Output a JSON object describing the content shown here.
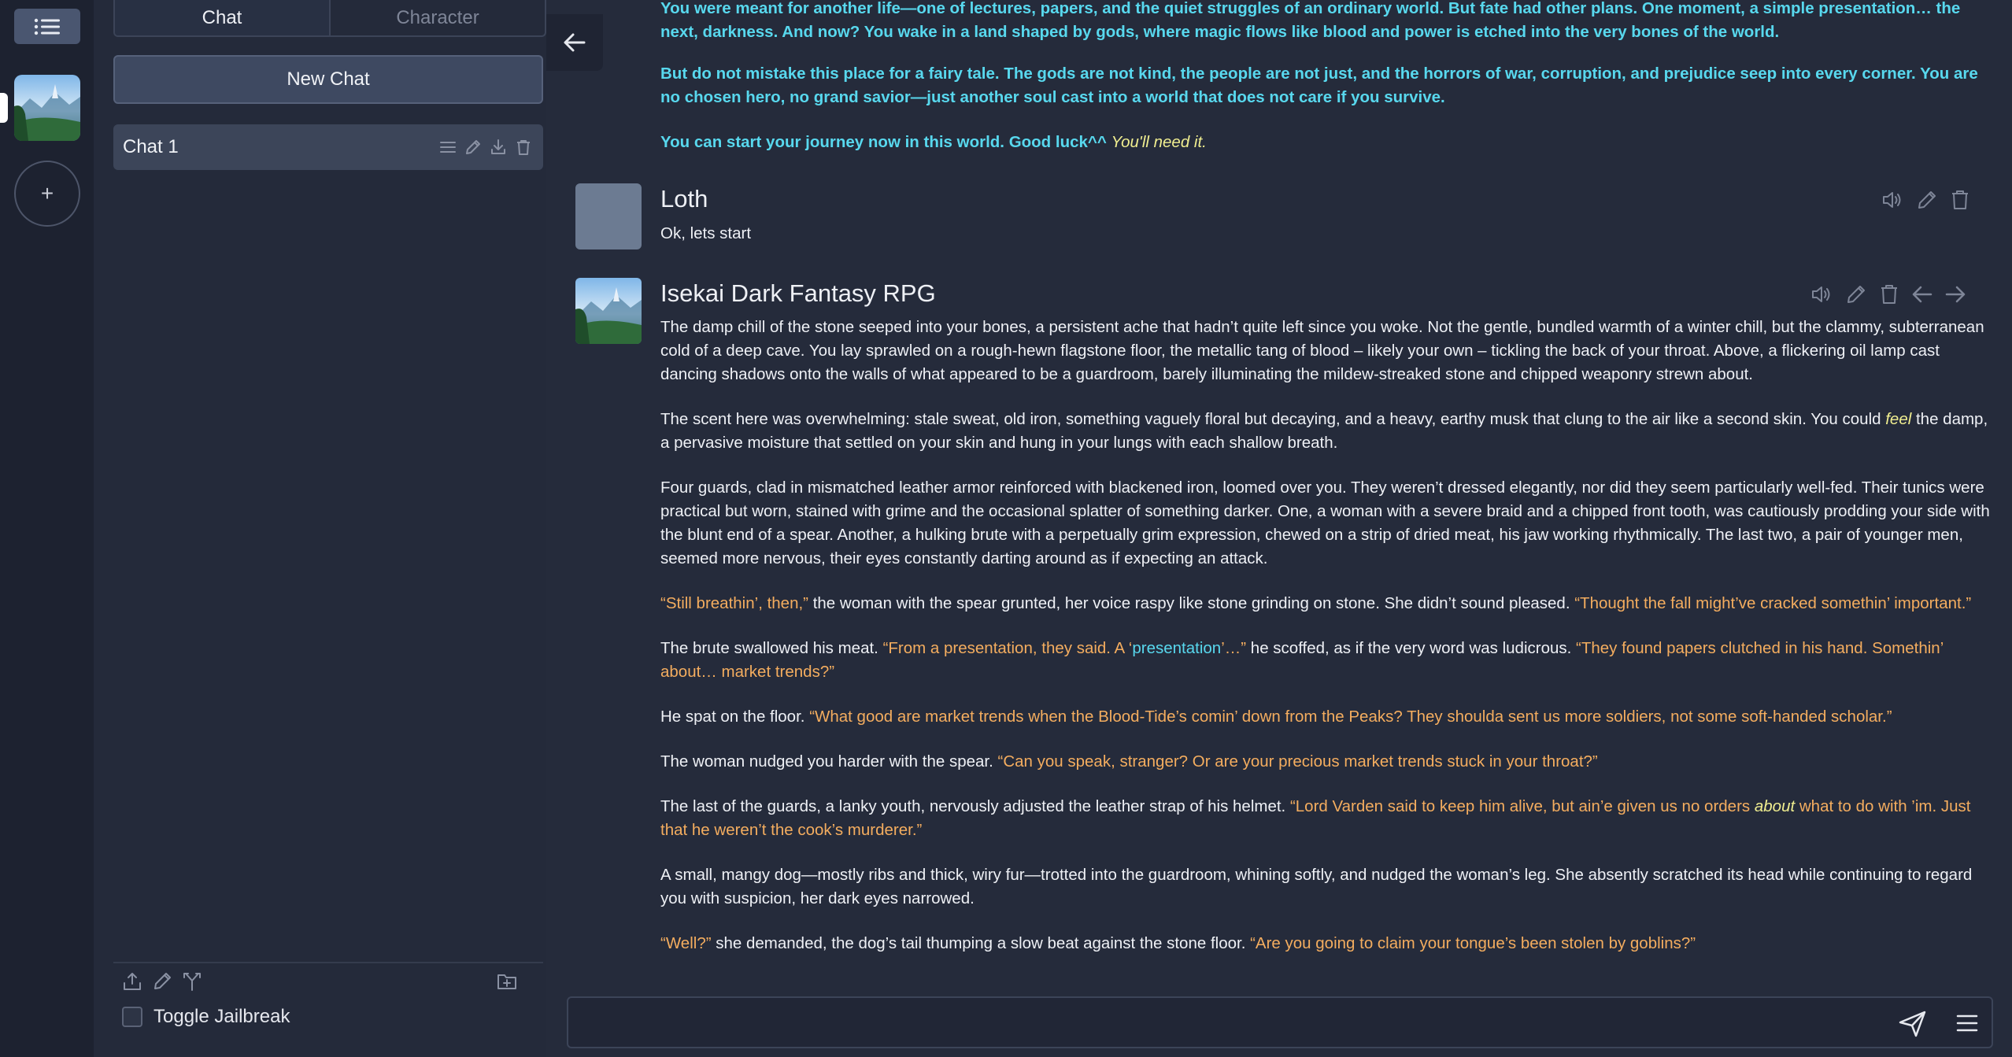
{
  "sidebar": {
    "menu_icon": "list-icon",
    "character_avatar": "fantasy-landscape-thumbnail",
    "add_icon": "plus-icon"
  },
  "panel": {
    "tabs": [
      {
        "label": "Chat",
        "active": true
      },
      {
        "label": "Character",
        "active": false
      }
    ],
    "new_chat_label": "New Chat",
    "chats": [
      {
        "label": "Chat 1",
        "icons": [
          "menu-icon",
          "pencil-icon",
          "download-icon",
          "trash-icon"
        ]
      }
    ],
    "footer_icons": [
      "upload-icon",
      "pencil-icon",
      "branch-icon",
      "folder-plus-icon"
    ],
    "jailbreak_label": "Toggle Jailbreak",
    "jailbreak_checked": false
  },
  "intro": {
    "p1": "You were meant for another life—one of lectures, papers, and the quiet struggles of an ordinary world. But fate had other plans. One moment, a simple presentation… the next, darkness. And now? You wake in a land shaped by gods, where magic flows like blood and power is etched into the very bones of the world.",
    "p2": "But do not mistake this place for a fairy tale. The gods are not kind, the people are not just, and the horrors of war, corruption, and prejudice seep into every corner. You are no chosen hero, no grand savior—just another soul cast into a world that does not care if you survive.",
    "p3_main": "You can start your journey now in this world. Good luck^^ ",
    "p3_italic": "You'll need it."
  },
  "messages": [
    {
      "name": "Loth",
      "text": "Ok, lets start",
      "actions": [
        "speaker-icon",
        "pencil-icon",
        "trash-icon"
      ]
    },
    {
      "name": "Isekai Dark Fantasy RPG",
      "actions": [
        "speaker-icon",
        "pencil-icon",
        "trash-icon",
        "arrow-left-icon",
        "arrow-right-icon"
      ],
      "paragraphs": [
        [
          {
            "t": "The damp chill of the stone seeped into your bones, a persistent ache that hadn’t quite left since you woke. Not the gentle, bundled warmth of a winter chill, but the clammy, subterranean cold of a deep cave. You lay sprawled on a rough-hewn flagstone floor, the metallic tang of blood – likely your own – tickling the back of your throat. Above, a flickering oil lamp cast dancing shadows onto the walls of what appeared to be a guardroom, barely illuminating the mildew-streaked stone and chipped weaponry strewn about.",
            "s": ""
          }
        ],
        [
          {
            "t": "The scent here was overwhelming: stale sweat, old iron, something vaguely floral but decaying, and a heavy, earthy musk that clung to the air like a second skin. You could ",
            "s": ""
          },
          {
            "t": "feel",
            "s": "it"
          },
          {
            "t": " the damp, a pervasive moisture that settled on your skin and hung in your lungs with each shallow breath.",
            "s": ""
          }
        ],
        [
          {
            "t": "Four guards, clad in mismatched leather armor reinforced with blackened iron, loomed over you. They weren’t dressed elegantly, nor did they seem particularly well-fed. Their tunics were practical but worn, stained with grime and the occasional splatter of something darker. One, a woman with a severe braid and a chipped front tooth, was cautiously prodding your side with the blunt end of a spear. Another, a hulking brute with a perpetually grim expression, chewed on a strip of dried meat, his jaw working rhythmically. The last two, a pair of younger men, seemed more nervous, their eyes constantly darting around as if expecting an attack.",
            "s": ""
          }
        ],
        [
          {
            "t": "“Still breathin’, then,”",
            "s": "q"
          },
          {
            "t": " the woman with the spear grunted, her voice raspy like stone grinding on stone. She didn’t sound pleased. ",
            "s": ""
          },
          {
            "t": "“Thought the fall might’ve cracked somethin’ important.”",
            "s": "q"
          }
        ],
        [
          {
            "t": "The brute swallowed his meat. ",
            "s": ""
          },
          {
            "t": "“From a presentation, they said. A ‘",
            "s": "q"
          },
          {
            "t": "presentation",
            "s": "qb"
          },
          {
            "t": "’…”",
            "s": "q"
          },
          {
            "t": " he scoffed, as if the very word was ludicrous. ",
            "s": ""
          },
          {
            "t": "“They found papers clutched in his hand. Somethin’ about… market trends?”",
            "s": "q"
          }
        ],
        [
          {
            "t": "He spat on the floor. ",
            "s": ""
          },
          {
            "t": "“What good are market trends when the Blood-Tide’s comin’ down from the Peaks? They shoulda sent us more soldiers, not some soft-handed scholar.”",
            "s": "q"
          }
        ],
        [
          {
            "t": "The woman nudged you harder with the spear. ",
            "s": ""
          },
          {
            "t": "“Can you speak, stranger? Or are your precious market trends stuck in your throat?”",
            "s": "q"
          }
        ],
        [
          {
            "t": "The last of the guards, a lanky youth, nervously adjusted the leather strap of his helmet. ",
            "s": ""
          },
          {
            "t": "“Lord Varden said to keep him alive, but ain’e given us no orders ",
            "s": "q"
          },
          {
            "t": "about",
            "s": "it"
          },
          {
            "t": " what to do with ’im. Just that he weren’t the cook’s murderer.”",
            "s": "q"
          }
        ],
        [
          {
            "t": "A small, mangy dog—mostly ribs and thick, wiry fur—trotted into the guardroom, whining softly, and nudged the woman’s leg. She absently scratched its head while continuing to regard you with suspicion, her dark eyes narrowed.",
            "s": ""
          }
        ],
        [
          {
            "t": "“Well?”",
            "s": "q"
          },
          {
            "t": " she demanded, the dog’s tail thumping a slow beat against the stone floor. ",
            "s": ""
          },
          {
            "t": "“Are you going to claim your tongue’s been stolen by goblins?”",
            "s": "q"
          }
        ]
      ]
    }
  ],
  "input": {
    "placeholder": "",
    "value": ""
  },
  "input_icons": [
    "send-icon",
    "hamburger-icon"
  ],
  "colors": {
    "accent_cyan": "#58d8ee",
    "dialogue_orange": "#f4ad5f",
    "italic_yellow": "#f0ee90",
    "background": "#252b3b"
  }
}
